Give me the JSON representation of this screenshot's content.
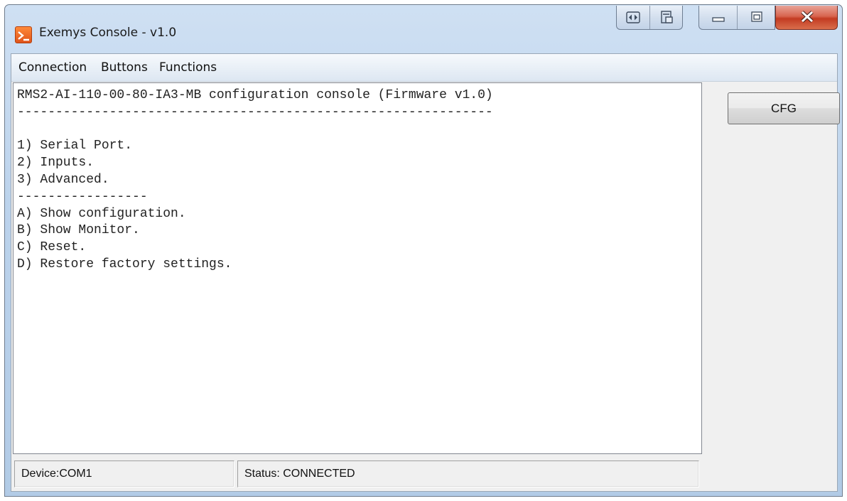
{
  "window": {
    "title": "Exemys Console - v1.0",
    "icons": {
      "app": "console-prompt-icon",
      "caption_extra_1": "resize-arrows-icon",
      "caption_extra_2": "copy-window-icon",
      "minimize": "minimize-icon",
      "maximize": "maximize-icon",
      "close": "close-icon"
    },
    "colors": {
      "close_button": "#c33b22",
      "app_icon": "#e0531a"
    }
  },
  "menu": {
    "items": [
      {
        "label": "Connection"
      },
      {
        "label": "Buttons"
      },
      {
        "label": "Functions"
      }
    ]
  },
  "console": {
    "lines": [
      "RMS2-AI-110-00-80-IA3-MB configuration console (Firmware v1.0)",
      "--------------------------------------------------------------",
      "",
      "1) Serial Port.",
      "2) Inputs.",
      "3) Advanced.",
      "-----------------",
      "A) Show configuration.",
      "B) Show Monitor.",
      "C) Reset.",
      "D) Restore factory settings."
    ]
  },
  "side_panel": {
    "cfg_button": "CFG"
  },
  "status": {
    "device": "Device:COM1",
    "status": "Status: CONNECTED"
  }
}
